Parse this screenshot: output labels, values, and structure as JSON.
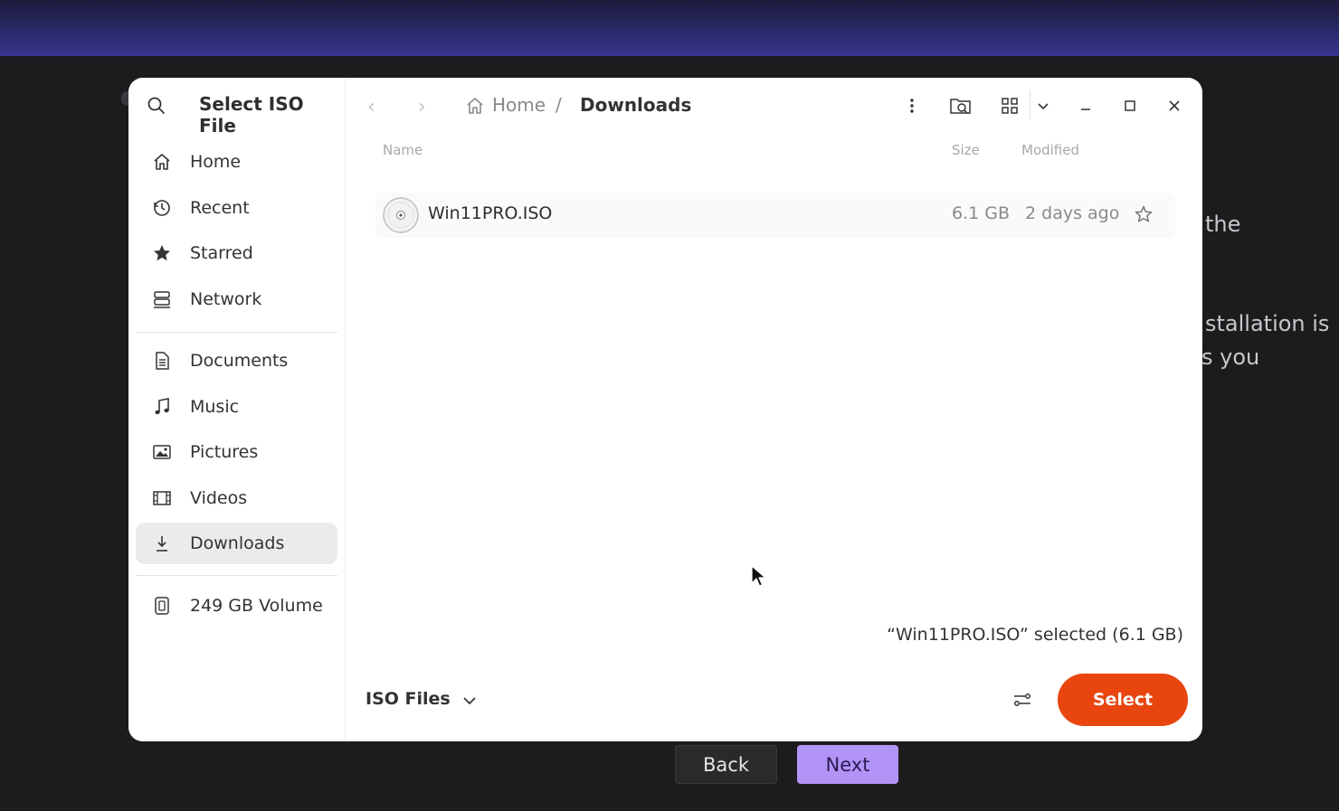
{
  "background": {
    "text_fragments": [
      "the",
      "stallation is",
      "s you"
    ],
    "back_label": "Back",
    "next_label": "Next"
  },
  "dialog": {
    "title": "Select ISO File",
    "sidebar": {
      "places": [
        {
          "label": "Home",
          "icon": "home-icon"
        },
        {
          "label": "Recent",
          "icon": "clock-icon"
        },
        {
          "label": "Starred",
          "icon": "star-icon"
        },
        {
          "label": "Network",
          "icon": "network-icon"
        }
      ],
      "folders": [
        {
          "label": "Documents",
          "icon": "document-icon"
        },
        {
          "label": "Music",
          "icon": "music-icon"
        },
        {
          "label": "Pictures",
          "icon": "picture-icon"
        },
        {
          "label": "Videos",
          "icon": "video-icon"
        },
        {
          "label": "Downloads",
          "icon": "download-icon",
          "active": true
        }
      ],
      "devices": [
        {
          "label": "249 GB Volume",
          "icon": "drive-icon"
        }
      ]
    },
    "breadcrumb": {
      "home": "Home",
      "separator": "/",
      "current": "Downloads"
    },
    "columns": {
      "name": "Name",
      "size": "Size",
      "modified": "Modified"
    },
    "files": [
      {
        "name": "Win11PRO.ISO",
        "size": "6.1 GB",
        "modified": "2 days ago",
        "icon": "disc-icon"
      }
    ],
    "status_text": "“Win11PRO.ISO” selected  (6.1 GB)",
    "filter_label": "ISO Files",
    "select_label": "Select",
    "accent_color": "#e8450f"
  }
}
